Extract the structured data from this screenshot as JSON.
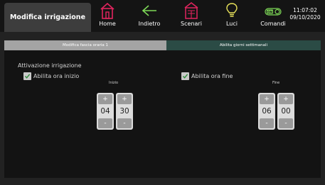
{
  "header": {
    "title": "Modifica irrigazione",
    "nav": [
      {
        "label": "Home",
        "icon": "home-icon"
      },
      {
        "label": "Indietro",
        "icon": "back-arrow-icon"
      },
      {
        "label": "Scenari",
        "icon": "scenes-icon"
      },
      {
        "label": "Luci",
        "icon": "lightbulb-icon"
      },
      {
        "label": "Comandi",
        "icon": "toggle-on-icon",
        "badge": "ON"
      }
    ],
    "time": "11:07:02",
    "date": "09/10/2020"
  },
  "tabs": [
    {
      "label": "Modifica fascia oraria 1",
      "active": true
    },
    {
      "label": "Abilita giorni settimanali",
      "active": false
    }
  ],
  "main": {
    "section_title": "Attivazione irrigazione",
    "start": {
      "checkbox_label": "Abilita ora inizio",
      "checked": true,
      "label": "Inizio",
      "hours": "04",
      "minutes": "30"
    },
    "end": {
      "checkbox_label": "Abilita ora fine",
      "checked": true,
      "label": "Fine",
      "hours": "06",
      "minutes": "00"
    },
    "plus": "+",
    "minus": "-"
  },
  "colors": {
    "accent": "#e0245e",
    "nav_green": "#7ed957",
    "bulb_yellow": "#e8e25a",
    "tab_active": "#a4a4a4",
    "tab_inactive": "#2b4b45",
    "background": "#222222",
    "panel": "#131313"
  }
}
